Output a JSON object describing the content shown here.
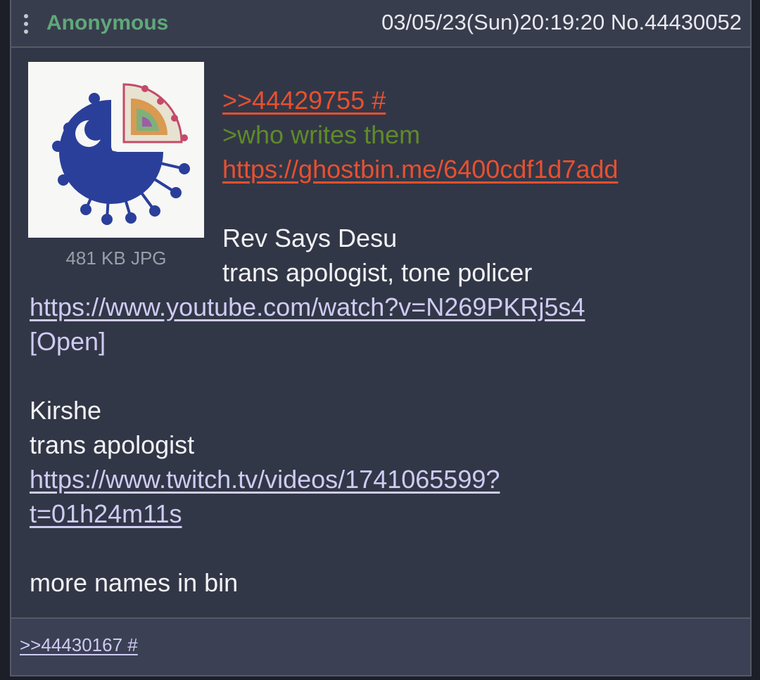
{
  "header": {
    "name": "Anonymous",
    "datetime": "03/05/23(Sun)20:19:20 No.44430052"
  },
  "file": {
    "info": "481 KB JPG"
  },
  "body": {
    "quote_link": ">>44429755 #",
    "greentext": ">who writes them",
    "bin_link": "https://ghostbin.me/6400cdf1d7add",
    "name1": "Rev Says Desu",
    "desc1": "trans apologist, tone policer",
    "youtube_link": "https://www.youtube.com/watch?v=N269PKRj5s4",
    "open_label": "[Open]",
    "name2": "Kirshe",
    "desc2": "trans apologist",
    "twitch_link_1": "https://www.twitch.tv/videos/1741065599?",
    "twitch_link_2": "t=01h24m11s",
    "closing": "more names in bin"
  },
  "footer": {
    "backlink": ">>44430167 #"
  },
  "colors": {
    "post_bg": "#323747",
    "name": "#5fa87a",
    "quote_link": "#e8502f",
    "greentext": "#5f8a2a",
    "ext_link": "#cfcbf2",
    "thumb_virus": "#2a3f9a"
  }
}
